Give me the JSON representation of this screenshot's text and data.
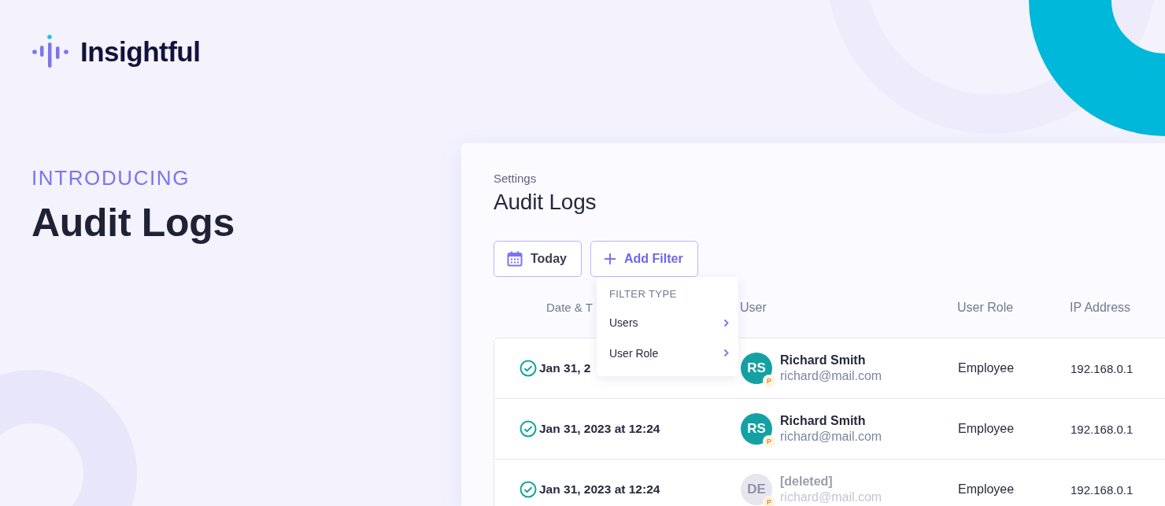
{
  "brand": {
    "name": "Insightful"
  },
  "hero": {
    "eyebrow": "INTRODUCING",
    "title": "Audit Logs"
  },
  "panel": {
    "breadcrumb": "Settings",
    "title": "Audit Logs",
    "buttons": [
      {
        "kind": "date",
        "label": "Today"
      },
      {
        "kind": "add",
        "label": "Add Filter"
      }
    ],
    "filter_menu": {
      "heading": "FILTER TYPE",
      "items": [
        "Users",
        "User Role"
      ]
    },
    "columns": [
      "Date & T",
      "User",
      "User Role",
      "IP Address"
    ],
    "rows": [
      {
        "date": "Jan 31, 2",
        "initials": "RS",
        "badge": "P",
        "name": "Richard Smith",
        "email": "richard@mail.com",
        "role": "Employee",
        "ip": "192.168.0.1",
        "deleted": false
      },
      {
        "date": "Jan 31, 2023 at 12:24",
        "initials": "RS",
        "badge": "P",
        "name": "Richard Smith",
        "email": "richard@mail.com",
        "role": "Employee",
        "ip": "192.168.0.1",
        "deleted": false
      },
      {
        "date": "Jan 31, 2023 at 12:24",
        "initials": "DE",
        "badge": "P",
        "name": "[deleted]",
        "email": "richard@mail.com",
        "role": "Employee",
        "ip": "192.168.0.1",
        "deleted": true
      }
    ]
  }
}
